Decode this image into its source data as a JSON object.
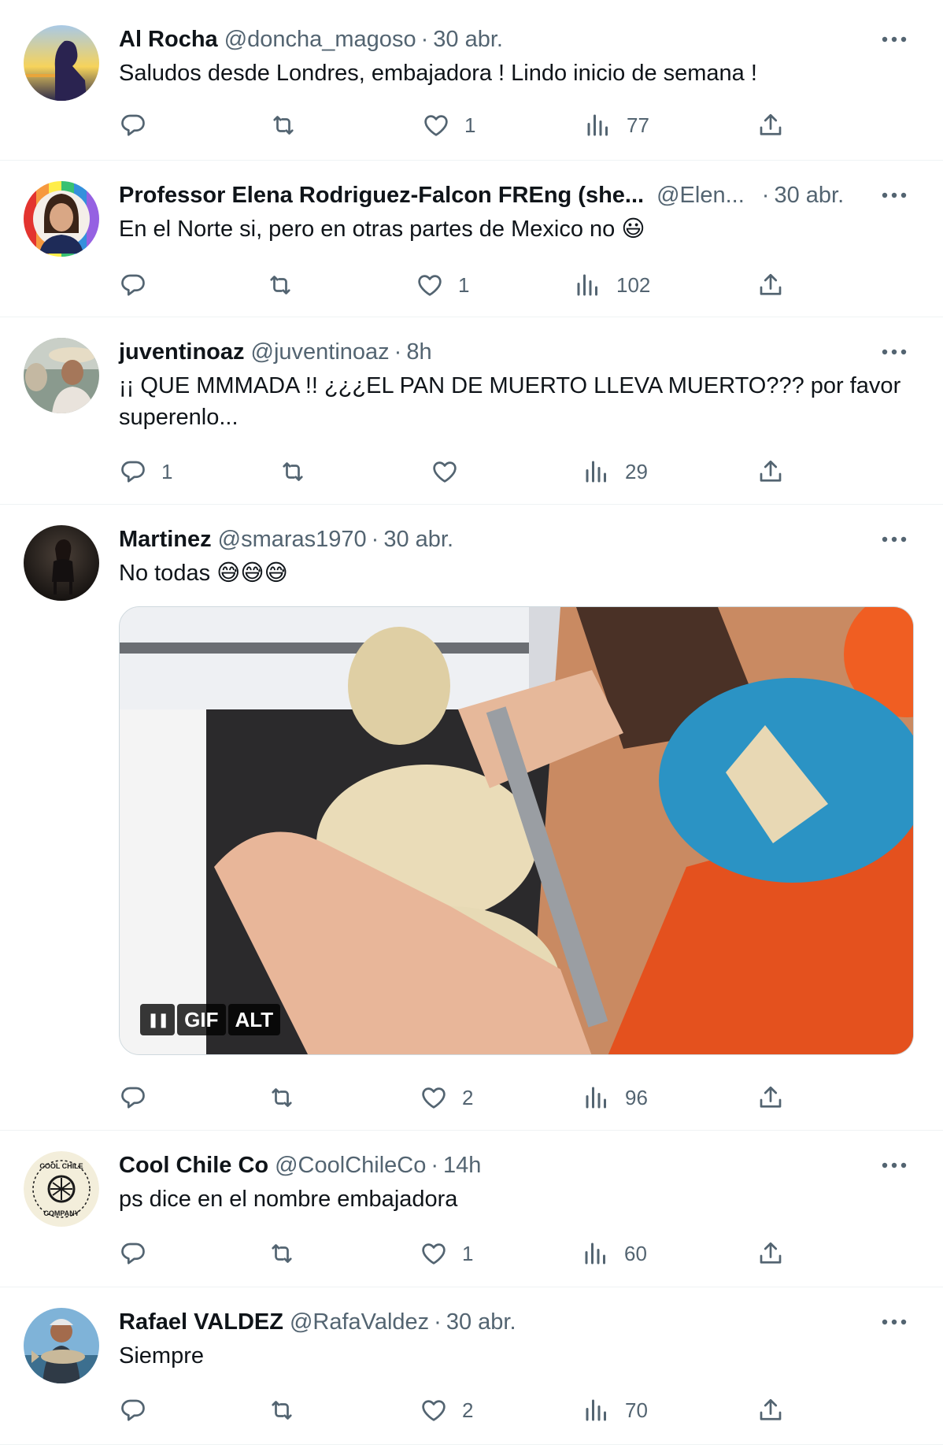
{
  "tweets": [
    {
      "name": "Al Rocha",
      "handle": "@doncha_magoso",
      "dot": "·",
      "time": "30 abr.",
      "text": "Saludos desde Londres, embajadora ! Lindo inicio de semana !",
      "replies": "",
      "likes": "1",
      "views": "77"
    },
    {
      "name": "Professor Elena Rodriguez-Falcon FREng (she...",
      "handle": "@Elen...",
      "dot": "·",
      "time": "30 abr.",
      "text": "En el Norte si, pero en otras partes de Mexico no 😃",
      "replies": "",
      "likes": "1",
      "views": "102"
    },
    {
      "name": "juventinoaz",
      "handle": "@juventinoaz",
      "dot": "·",
      "time": "8h",
      "text": "¡¡ QUE MMMADA !! ¿¿¿EL PAN DE MUERTO LLEVA MUERTO??? por favor superenlo...",
      "replies": "1",
      "likes": "",
      "views": "29"
    },
    {
      "name": "Martinez",
      "handle": "@smaras1970",
      "dot": "·",
      "time": "30 abr.",
      "text": "No todas 😅😅😅",
      "replies": "",
      "likes": "2",
      "views": "96",
      "media_controls": {
        "pause": "❚❚",
        "gif": "GIF",
        "alt": "ALT"
      }
    },
    {
      "name": "Cool Chile Co",
      "handle": "@CoolChileCo",
      "dot": "·",
      "time": "14h",
      "text": "ps dice en el nombre embajadora",
      "replies": "",
      "likes": "1",
      "views": "60"
    },
    {
      "name": "Rafael VALDEZ",
      "handle": "@RafaValdez",
      "dot": "·",
      "time": "30 abr.",
      "text": "Siempre",
      "replies": "",
      "likes": "2",
      "views": "70"
    }
  ],
  "icons": {
    "more": "more-horizontal-icon",
    "reply": "reply-icon",
    "retweet": "retweet-icon",
    "like": "heart-icon",
    "views": "analytics-icon",
    "share": "share-icon"
  },
  "colors": {
    "text": "#0f1419",
    "secondary": "#536471",
    "border": "#eff3f4"
  }
}
